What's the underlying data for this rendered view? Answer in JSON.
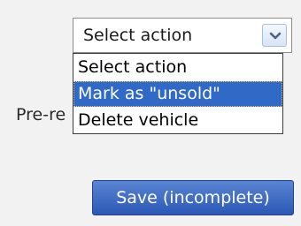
{
  "action_select": {
    "selected_value": "Select action",
    "options": [
      "Select action",
      "Mark as \"unsold\"",
      "Delete vehicle"
    ],
    "highlighted_option": "Mark as \"unsold\""
  },
  "field_label_partial": "Pre-re",
  "save_button": {
    "label": "Save (incomplete)"
  },
  "icons": {
    "dropdown_arrow": "chevron-down-icon"
  },
  "colors": {
    "highlight": "#3169c6",
    "button": "#2b58b5",
    "background": "#f2f2f2"
  }
}
